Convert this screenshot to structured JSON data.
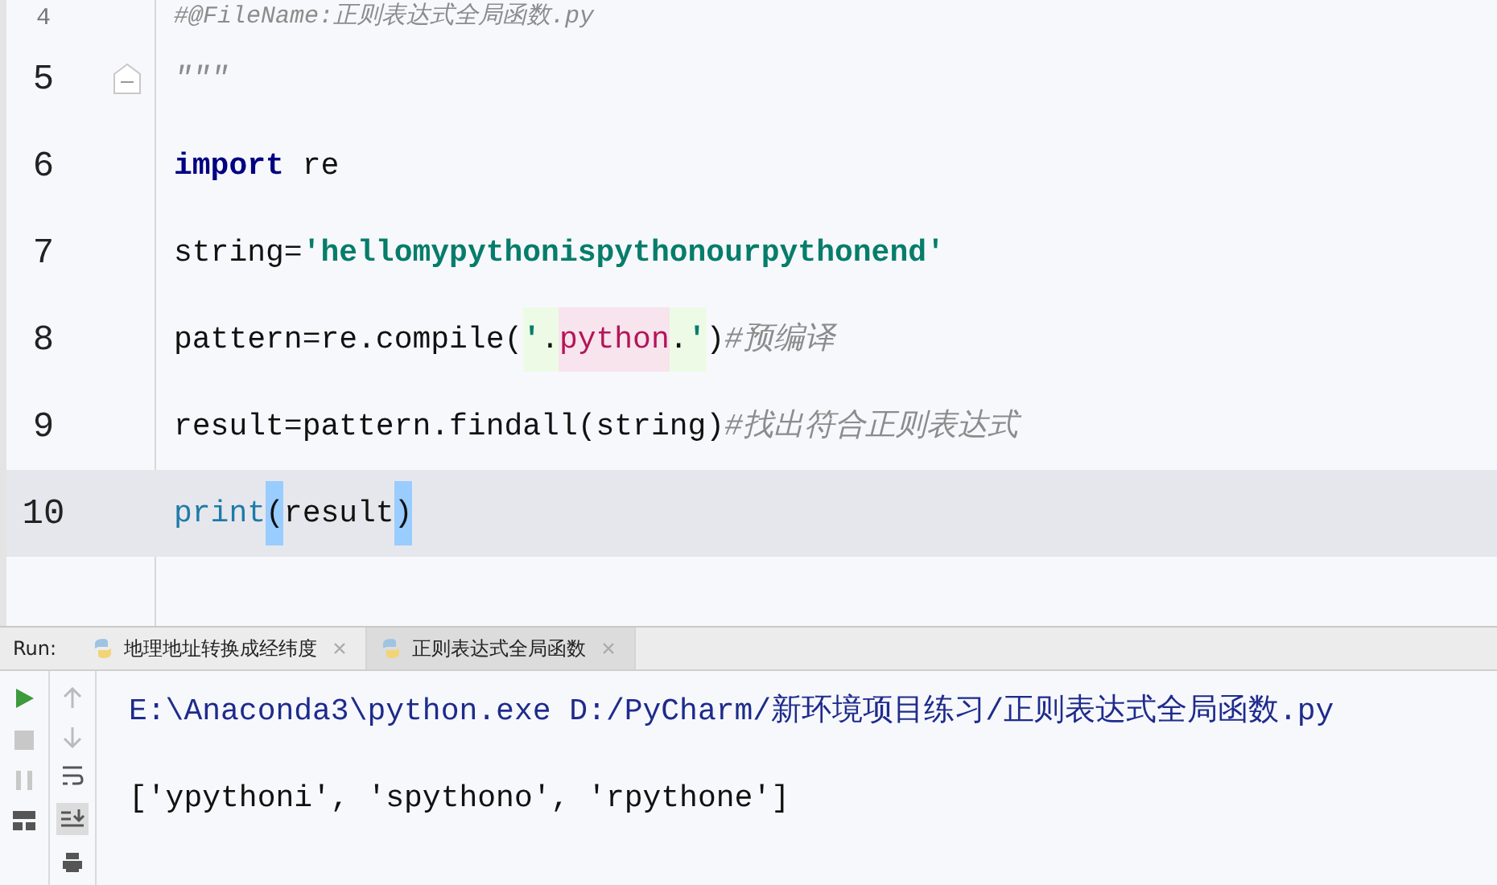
{
  "editor": {
    "lines": [
      {
        "number": "4",
        "current": false,
        "fold": false,
        "tokens": [
          {
            "kind": "comment",
            "text": "#@FileName:正则表达式全局函数.py"
          }
        ]
      },
      {
        "number": "5",
        "current": false,
        "fold": true,
        "tokens": [
          {
            "kind": "comment",
            "text": "\"\"\""
          }
        ]
      },
      {
        "number": "6",
        "current": false,
        "fold": false,
        "tokens": [
          {
            "kind": "keyword",
            "text": "import"
          },
          {
            "kind": "plain",
            "text": " re"
          }
        ]
      },
      {
        "number": "7",
        "current": false,
        "fold": false,
        "tokens": [
          {
            "kind": "plain",
            "text": "string="
          },
          {
            "kind": "string",
            "text": "'hellomypythonispythonourpythonend'"
          }
        ]
      },
      {
        "number": "8",
        "current": false,
        "fold": false,
        "tokens": [
          {
            "kind": "plain",
            "text": "pattern=re.compile("
          },
          {
            "kind": "inj-quote",
            "text": "'"
          },
          {
            "kind": "inj-plain",
            "text": "."
          },
          {
            "kind": "regex",
            "text": "python"
          },
          {
            "kind": "inj-plain",
            "text": "."
          },
          {
            "kind": "inj-quote",
            "text": "'"
          },
          {
            "kind": "plain",
            "text": ")"
          },
          {
            "kind": "comment",
            "text": "#预编译"
          }
        ]
      },
      {
        "number": "9",
        "current": false,
        "fold": false,
        "tokens": [
          {
            "kind": "plain",
            "text": "result=pattern.findall(string)"
          },
          {
            "kind": "comment",
            "text": "#找出符合正则表达式"
          }
        ]
      },
      {
        "number": "10",
        "current": true,
        "fold": false,
        "tokens": [
          {
            "kind": "builtin",
            "text": "print"
          },
          {
            "kind": "brace",
            "text": "("
          },
          {
            "kind": "plain",
            "text": "result"
          },
          {
            "kind": "brace",
            "text": ")"
          }
        ]
      }
    ]
  },
  "run_panel": {
    "label": "Run:",
    "tabs": [
      {
        "label": "地理地址转换成经纬度",
        "selected": false
      },
      {
        "label": "正则表达式全局函数",
        "selected": true
      }
    ],
    "console": [
      {
        "kind": "command",
        "text": "E:\\Anaconda3\\python.exe D:/PyCharm/新环境项目练习/正则表达式全局函数.py"
      },
      {
        "kind": "output",
        "text": "['ypythoni', 'spythono', 'rpythone']"
      }
    ]
  }
}
